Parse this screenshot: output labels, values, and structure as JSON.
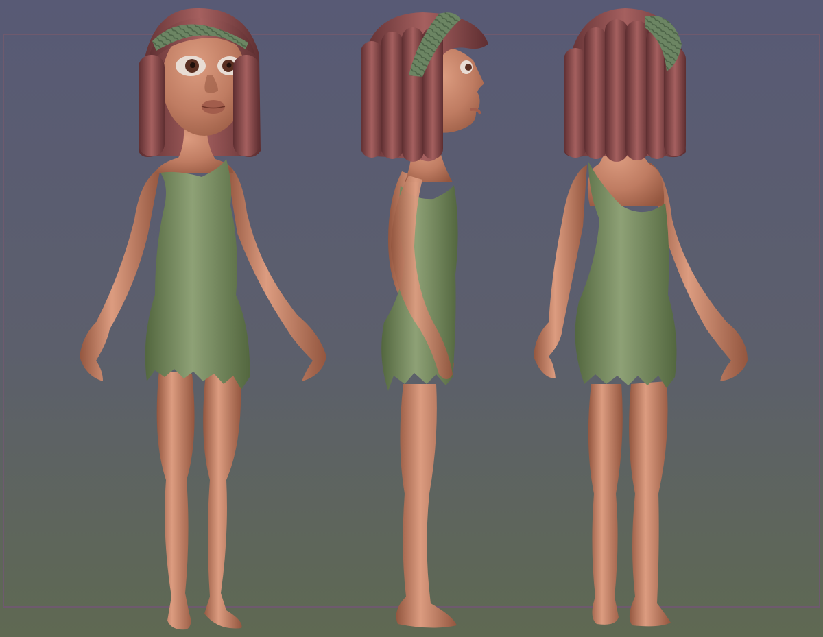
{
  "scene": {
    "colors": {
      "bg_top": "#585a75",
      "bg_mid": "#5c5f6c",
      "bg_bottom": "#5f6952",
      "frame_line": "#6e5a6e",
      "skin": "#bf7c62",
      "skin_shadow": "#93563f",
      "skin_light": "#dc9c80",
      "hair": "#8a4a4c",
      "hair_dark": "#5e2e31",
      "hair_light": "#a5605f",
      "headband": "#6c8563",
      "headband_dark": "#4d6448",
      "dress": "#748860",
      "dress_dark": "#53673f",
      "dress_light": "#8ea176",
      "eye_white": "#e8dcd4",
      "iris": "#5a2f22",
      "lips": "#a25d4c"
    },
    "views": [
      {
        "name": "front",
        "icon": "figure-front-view-icon"
      },
      {
        "name": "side",
        "icon": "figure-side-view-icon"
      },
      {
        "name": "back",
        "icon": "figure-back-view-icon"
      }
    ]
  }
}
